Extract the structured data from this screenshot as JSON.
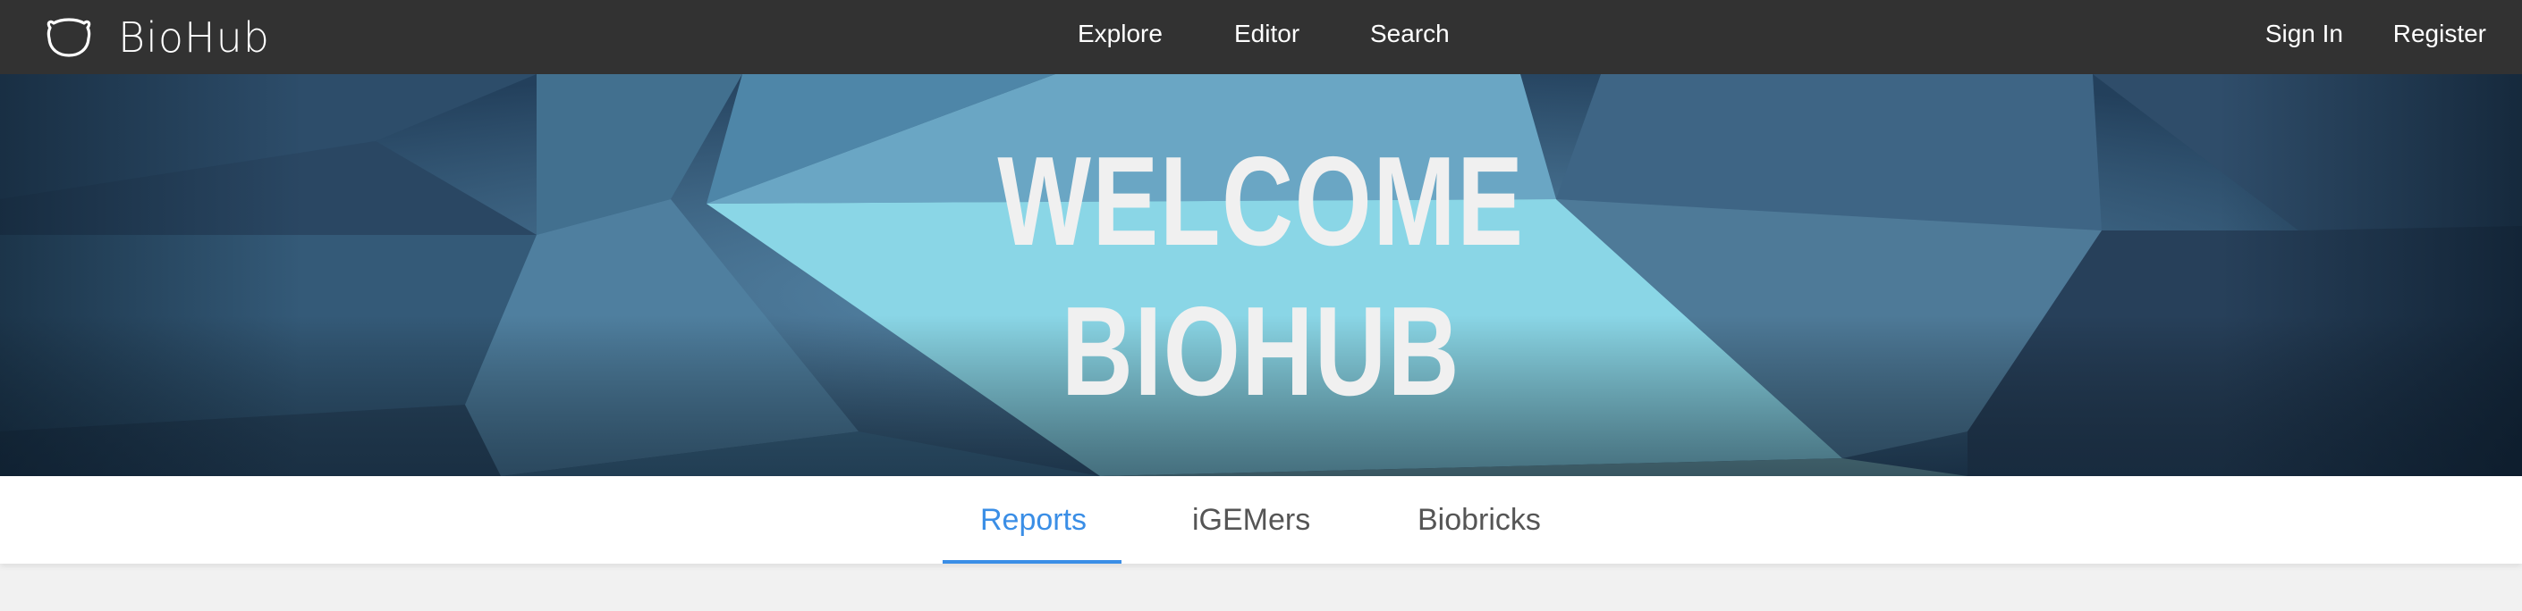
{
  "navbar": {
    "brand": "BioHub",
    "links": {
      "explore": "Explore",
      "editor": "Editor",
      "search": "Search"
    },
    "auth": {
      "sign_in": "Sign In",
      "register": "Register"
    },
    "background": "#323232"
  },
  "hero": {
    "line1": "WELCOME",
    "line2": "BIOHUB",
    "text_color": "#f0f0f0"
  },
  "tabs": {
    "items": [
      "Reports",
      "iGEMers",
      "Biobricks"
    ],
    "active": "Reports",
    "accent": "#3a8ee6"
  },
  "icons": {
    "logo": "bear-logo-icon"
  }
}
